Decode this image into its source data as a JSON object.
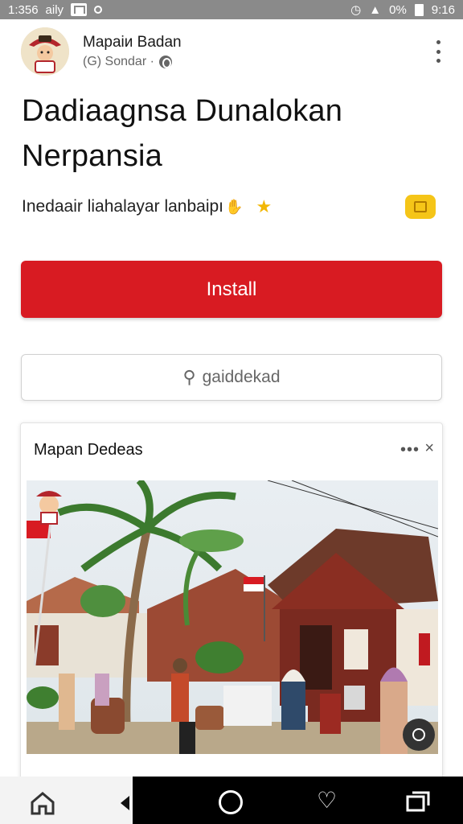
{
  "status_bar": {
    "time": "1:356",
    "left_text": "aily",
    "battery_pct": "0%",
    "right_time": "9:16"
  },
  "post": {
    "author": "Mapaiи Badan",
    "meta": "(G) Sondar ·",
    "title": "Dadiaagnsa Dunalokan Nerpansia",
    "subtitle": "Inedaair liahalayar lanbaipı",
    "install_label": "Install",
    "secondary_label": "gaiddekad"
  },
  "card": {
    "title": "Mapan Dedeas",
    "more_label": "•••",
    "close_label": "×"
  },
  "icons": {
    "status": [
      "mail-icon",
      "dot-icon",
      "alarm-icon",
      "signal-icon",
      "battery-icon"
    ],
    "nav": [
      "home-icon",
      "back-icon",
      "circle-icon",
      "heart-icon",
      "recent-apps-icon"
    ]
  },
  "colors": {
    "install": "#d81b22",
    "accent_yellow": "#f5c518",
    "status_bar": "#8a8a8a"
  }
}
